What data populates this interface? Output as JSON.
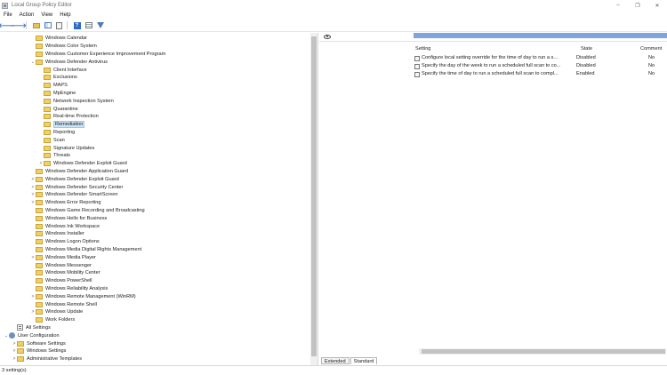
{
  "window": {
    "title": "Local Group Policy Editor",
    "controls": [
      "–",
      "❐",
      "✕"
    ]
  },
  "menu": [
    "File",
    "Action",
    "View",
    "Help"
  ],
  "toolbar": {
    "icons": [
      "back-arrow-icon",
      "forward-arrow-icon",
      "folder-up-icon",
      "show-hide-tree-icon",
      "properties-icon",
      "help-icon",
      "export-list-icon",
      "filter-icon"
    ],
    "back": "🡐",
    "forward": "🡒",
    "help": "?"
  },
  "tree": {
    "items": [
      {
        "label": "Windows Calendar",
        "indent": 2,
        "expander": "",
        "kind": "folder"
      },
      {
        "label": "Windows Color System",
        "indent": 2,
        "expander": "",
        "kind": "folder"
      },
      {
        "label": "Windows Customer Experience Improvement Program",
        "indent": 2,
        "expander": "",
        "kind": "folder"
      },
      {
        "label": "Windows Defender Antivirus",
        "indent": 2,
        "expander": "⌄",
        "kind": "folder"
      },
      {
        "label": "Client Interface",
        "indent": 3,
        "expander": "",
        "kind": "folder"
      },
      {
        "label": "Exclusions",
        "indent": 3,
        "expander": "",
        "kind": "folder"
      },
      {
        "label": "MAPS",
        "indent": 3,
        "expander": "",
        "kind": "folder"
      },
      {
        "label": "MpEngine",
        "indent": 3,
        "expander": "",
        "kind": "folder"
      },
      {
        "label": "Network Inspection System",
        "indent": 3,
        "expander": "",
        "kind": "folder"
      },
      {
        "label": "Quarantine",
        "indent": 3,
        "expander": "",
        "kind": "folder"
      },
      {
        "label": "Real-time Protection",
        "indent": 3,
        "expander": "",
        "kind": "folder"
      },
      {
        "label": "Remediation",
        "indent": 3,
        "expander": "",
        "kind": "folder",
        "selected": true
      },
      {
        "label": "Reporting",
        "indent": 3,
        "expander": "",
        "kind": "folder"
      },
      {
        "label": "Scan",
        "indent": 3,
        "expander": "",
        "kind": "folder"
      },
      {
        "label": "Signature Updates",
        "indent": 3,
        "expander": "",
        "kind": "folder"
      },
      {
        "label": "Threats",
        "indent": 3,
        "expander": "",
        "kind": "folder"
      },
      {
        "label": "Windows Defender Exploit Guard",
        "indent": 3,
        "expander": ">",
        "kind": "folder"
      },
      {
        "label": "Windows Defender Application Guard",
        "indent": 2,
        "expander": "",
        "kind": "folder"
      },
      {
        "label": "Windows Defender Exploit Guard",
        "indent": 2,
        "expander": ">",
        "kind": "folder"
      },
      {
        "label": "Windows Defender Security Center",
        "indent": 2,
        "expander": ">",
        "kind": "folder"
      },
      {
        "label": "Windows Defender SmartScreen",
        "indent": 2,
        "expander": ">",
        "kind": "folder"
      },
      {
        "label": "Windows Error Reporting",
        "indent": 2,
        "expander": ">",
        "kind": "folder"
      },
      {
        "label": "Windows Game Recording and Broadcasting",
        "indent": 2,
        "expander": "",
        "kind": "folder"
      },
      {
        "label": "Windows Hello for Business",
        "indent": 2,
        "expander": "",
        "kind": "folder"
      },
      {
        "label": "Windows Ink Workspace",
        "indent": 2,
        "expander": "",
        "kind": "folder"
      },
      {
        "label": "Windows Installer",
        "indent": 2,
        "expander": "",
        "kind": "folder"
      },
      {
        "label": "Windows Logon Options",
        "indent": 2,
        "expander": "",
        "kind": "folder"
      },
      {
        "label": "Windows Media Digital Rights Management",
        "indent": 2,
        "expander": "",
        "kind": "folder"
      },
      {
        "label": "Windows Media Player",
        "indent": 2,
        "expander": ">",
        "kind": "folder"
      },
      {
        "label": "Windows Messenger",
        "indent": 2,
        "expander": "",
        "kind": "folder"
      },
      {
        "label": "Windows Mobility Center",
        "indent": 2,
        "expander": "",
        "kind": "folder"
      },
      {
        "label": "Windows PowerShell",
        "indent": 2,
        "expander": "",
        "kind": "folder"
      },
      {
        "label": "Windows Reliability Analysis",
        "indent": 2,
        "expander": "",
        "kind": "folder"
      },
      {
        "label": "Windows Remote Management (WinRM)",
        "indent": 2,
        "expander": ">",
        "kind": "folder"
      },
      {
        "label": "Windows Remote Shell",
        "indent": 2,
        "expander": "",
        "kind": "folder"
      },
      {
        "label": "Windows Update",
        "indent": 2,
        "expander": ">",
        "kind": "folder"
      },
      {
        "label": "Work Folders",
        "indent": 2,
        "expander": "",
        "kind": "folder"
      },
      {
        "label": "All Settings",
        "indent": 1,
        "expander": "",
        "kind": "settings"
      },
      {
        "label": "User Configuration",
        "indent": 0,
        "expander": "⌄",
        "kind": "user"
      },
      {
        "label": "Software Settings",
        "indent": 1,
        "expander": ">",
        "kind": "folder"
      },
      {
        "label": "Windows Settings",
        "indent": 1,
        "expander": ">",
        "kind": "folder"
      },
      {
        "label": "Administrative Templates",
        "indent": 1,
        "expander": ">",
        "kind": "folder"
      }
    ]
  },
  "grid": {
    "columns": {
      "setting": "Setting",
      "state": "State",
      "comment": "Comment"
    },
    "rows": [
      {
        "setting": "Configure local setting override for the time of day to run a s...",
        "state": "Disabled",
        "comment": "No"
      },
      {
        "setting": "Specify the day of the week to run a scheduled full scan to co...",
        "state": "Disabled",
        "comment": "No"
      },
      {
        "setting": "Specify the time of day to run a scheduled full scan to compl...",
        "state": "Enabled",
        "comment": "No"
      }
    ]
  },
  "tabs": [
    "Extended",
    "Standard"
  ],
  "status": {
    "text": "3 setting(s)"
  },
  "colors": {
    "selection": "#cce4f7",
    "folder": "#f2cf63",
    "accent": "#2b6cc4",
    "strip": "#7ea6dd"
  }
}
